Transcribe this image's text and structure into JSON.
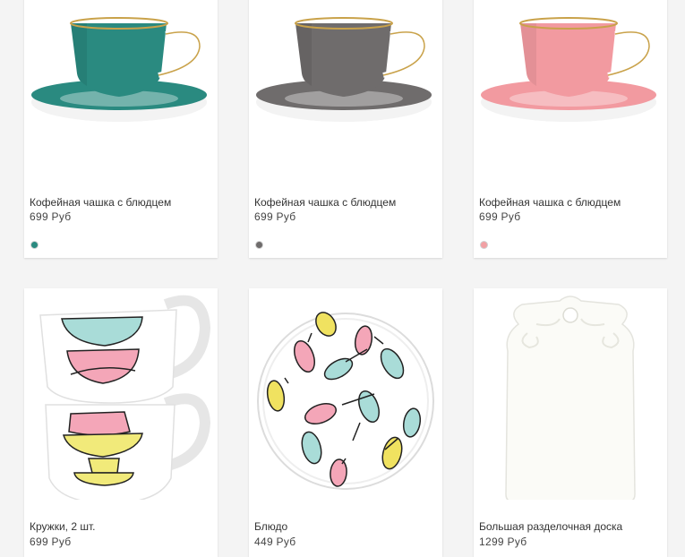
{
  "products": [
    {
      "name": "Кофейная чашка с блюдцем",
      "price": "699 Руб",
      "swatch": "#2a8a80",
      "cup_color": "#2a8a80",
      "cup_dark": "#1f6f68"
    },
    {
      "name": "Кофейная чашка с блюдцем",
      "price": "699 Руб",
      "swatch": "#6f6c6c",
      "cup_color": "#6f6c6c",
      "cup_dark": "#575454"
    },
    {
      "name": "Кофейная чашка с блюдцем",
      "price": "699 Руб",
      "swatch": "#f2a0a4",
      "cup_color": "#f29aa0",
      "cup_dark": "#e58489"
    },
    {
      "name": "Кружки, 2 шт.",
      "price": "699 Руб"
    },
    {
      "name": "Блюдо",
      "price": "449 Руб"
    },
    {
      "name": "Большая разделочная доска",
      "price": "1299 Руб"
    }
  ],
  "colors": {
    "gold_rim": "#c9a24a",
    "mug_pink": "#f4a6b8",
    "mug_yellow": "#f1ea7a",
    "mug_teal": "#a9dcd8",
    "spoon_pink": "#f4a6b8",
    "spoon_yellow": "#f0e260",
    "spoon_teal": "#a9dcd8"
  }
}
